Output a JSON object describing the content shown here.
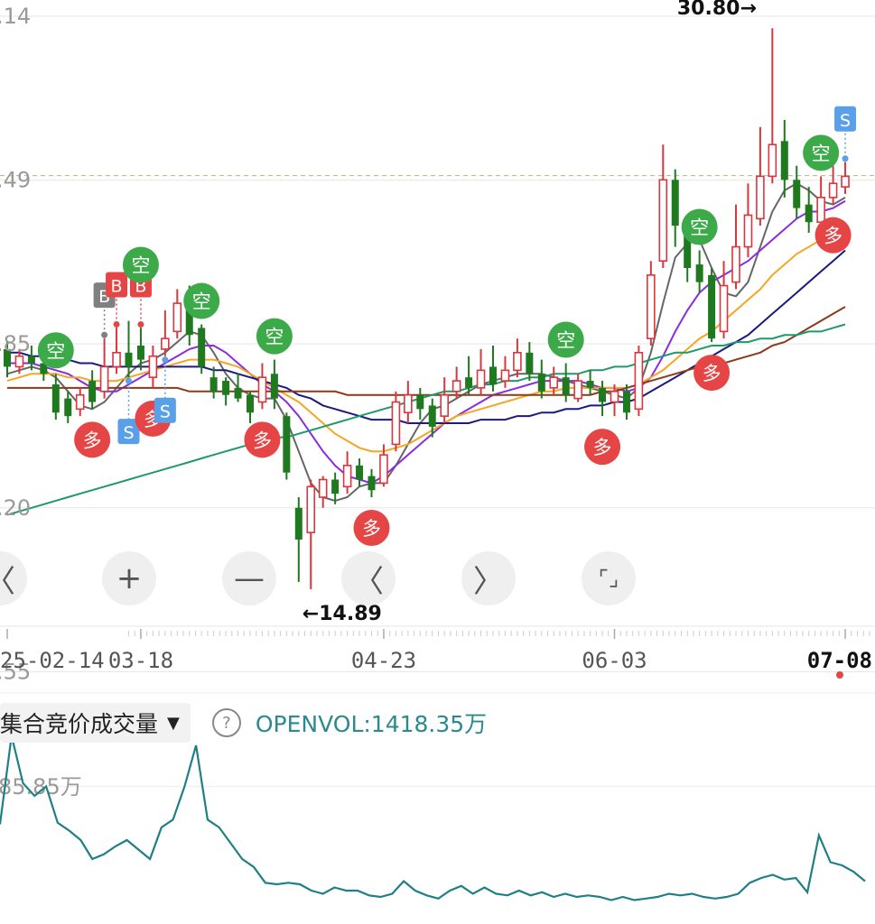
{
  "chart_data": {
    "type": "candlestick",
    "price_axis": {
      "ylim": [
        14.2,
        31.6
      ],
      "tick_labels": [
        ".14",
        ".49",
        ".85",
        ".20",
        ".55"
      ],
      "tick_values": [
        31.14,
        26.49,
        21.85,
        17.2,
        12.55
      ],
      "reference_line": 26.62
    },
    "max_marker": {
      "label": "30.80→",
      "value": 30.8,
      "day": 62
    },
    "min_marker": {
      "label": "←14.89",
      "value": 14.89,
      "day": 24
    },
    "x_ticks": [
      {
        "label": "25-02-14",
        "day": 0
      },
      {
        "label": "03-18",
        "day": 11
      },
      {
        "label": "04-23",
        "day": 31
      },
      {
        "label": "06-03",
        "day": 50
      },
      {
        "label": "07-08",
        "day": 69
      }
    ],
    "candles": [
      [
        21.7,
        21.2,
        21.9,
        20.9
      ],
      [
        21.2,
        21.5,
        21.7,
        21.0
      ],
      [
        21.5,
        21.3,
        21.8,
        21.1
      ],
      [
        21.3,
        21.0,
        21.6,
        20.8
      ],
      [
        20.7,
        19.9,
        21.0,
        19.7
      ],
      [
        20.3,
        19.8,
        20.5,
        19.6
      ],
      [
        20.0,
        20.4,
        20.6,
        19.8
      ],
      [
        20.8,
        20.2,
        21.1,
        20.0
      ],
      [
        20.5,
        21.2,
        22.0,
        20.3
      ],
      [
        21.2,
        21.6,
        22.3,
        21.0
      ],
      [
        21.6,
        21.2,
        22.5,
        20.9
      ],
      [
        21.8,
        21.4,
        22.3,
        21.1
      ],
      [
        20.9,
        21.5,
        21.8,
        20.6
      ],
      [
        21.7,
        22.0,
        22.8,
        21.5
      ],
      [
        22.2,
        23.0,
        23.4,
        22.0
      ],
      [
        23.0,
        22.1,
        23.5,
        21.8
      ],
      [
        22.3,
        21.2,
        22.4,
        21.0
      ],
      [
        20.9,
        20.5,
        21.2,
        20.3
      ],
      [
        20.8,
        20.4,
        20.9,
        20.1
      ],
      [
        20.6,
        20.3,
        21.0,
        20.2
      ],
      [
        20.4,
        19.9,
        20.5,
        19.6
      ],
      [
        20.2,
        20.9,
        21.3,
        20.0
      ],
      [
        21.0,
        20.3,
        21.4,
        20.0
      ],
      [
        19.8,
        18.2,
        19.9,
        18.0
      ],
      [
        17.2,
        16.3,
        17.5,
        15.1
      ],
      [
        16.5,
        17.8,
        18.0,
        14.89
      ],
      [
        17.5,
        18.0,
        18.1,
        17.2
      ],
      [
        18.0,
        17.6,
        18.2,
        17.3
      ],
      [
        17.8,
        18.4,
        18.8,
        17.6
      ],
      [
        18.4,
        18.0,
        18.6,
        17.8
      ],
      [
        18.1,
        17.7,
        18.3,
        17.5
      ],
      [
        17.9,
        18.7,
        19.0,
        17.8
      ],
      [
        19.0,
        20.2,
        20.5,
        18.8
      ],
      [
        19.9,
        20.4,
        20.8,
        19.6
      ],
      [
        20.4,
        20.0,
        20.6,
        19.7
      ],
      [
        20.1,
        19.5,
        20.3,
        19.2
      ],
      [
        19.8,
        20.4,
        20.9,
        19.6
      ],
      [
        20.5,
        20.8,
        21.2,
        20.3
      ],
      [
        20.9,
        20.6,
        21.5,
        20.4
      ],
      [
        20.6,
        21.1,
        21.7,
        20.4
      ],
      [
        21.2,
        20.7,
        21.8,
        20.5
      ],
      [
        20.8,
        21.1,
        21.5,
        20.6
      ],
      [
        21.1,
        21.6,
        22.0,
        20.9
      ],
      [
        21.6,
        21.0,
        21.9,
        20.8
      ],
      [
        21.0,
        20.5,
        21.4,
        20.3
      ],
      [
        20.6,
        20.9,
        21.2,
        20.4
      ],
      [
        20.9,
        20.4,
        21.3,
        20.2
      ],
      [
        20.3,
        20.8,
        21.0,
        20.2
      ],
      [
        20.8,
        20.6,
        21.1,
        20.4
      ],
      [
        20.6,
        20.2,
        20.8,
        19.8
      ],
      [
        20.2,
        20.5,
        20.7,
        19.8
      ],
      [
        20.5,
        19.9,
        20.7,
        19.7
      ],
      [
        20.0,
        21.6,
        21.8,
        19.8
      ],
      [
        22.0,
        23.8,
        24.2,
        21.8
      ],
      [
        24.2,
        26.5,
        27.5,
        24.0
      ],
      [
        26.5,
        25.2,
        26.8,
        24.6
      ],
      [
        25.0,
        24.0,
        25.3,
        23.6
      ],
      [
        24.1,
        23.6,
        24.5,
        23.3
      ],
      [
        23.8,
        22.0,
        24.0,
        21.9
      ],
      [
        22.2,
        23.5,
        24.2,
        22.0
      ],
      [
        23.6,
        24.6,
        25.8,
        23.4
      ],
      [
        24.6,
        25.5,
        26.4,
        24.3
      ],
      [
        25.4,
        26.6,
        28.0,
        25.2
      ],
      [
        26.6,
        27.5,
        30.8,
        26.4
      ],
      [
        27.6,
        26.5,
        28.2,
        26.0
      ],
      [
        26.5,
        25.7,
        26.9,
        25.4
      ],
      [
        25.8,
        25.3,
        26.3,
        25.0
      ],
      [
        25.3,
        26.0,
        26.6,
        25.2
      ],
      [
        26.0,
        26.4,
        26.9,
        25.8
      ],
      [
        26.3,
        26.6,
        27.0,
        26.1
      ]
    ],
    "signals": [
      {
        "label": "空",
        "day": 4,
        "kind": "short",
        "pos": "above"
      },
      {
        "label": "多",
        "day": 7,
        "kind": "long",
        "pos": "below"
      },
      {
        "label": "B",
        "day": 8,
        "kind": "buy-gray",
        "pos": "above"
      },
      {
        "label": "B",
        "day": 9,
        "kind": "buy",
        "pos": "above"
      },
      {
        "label": "B",
        "day": 11,
        "kind": "buy",
        "pos": "above"
      },
      {
        "label": "空",
        "day": 11,
        "kind": "short",
        "pos": "above"
      },
      {
        "label": "S",
        "day": 10,
        "kind": "sell",
        "pos": "below"
      },
      {
        "label": "多",
        "day": 12,
        "kind": "long",
        "pos": "below"
      },
      {
        "label": "S",
        "day": 13,
        "kind": "sell",
        "pos": "below"
      },
      {
        "label": "空",
        "day": 16,
        "kind": "short",
        "pos": "above"
      },
      {
        "label": "空",
        "day": 22,
        "kind": "short",
        "pos": "above"
      },
      {
        "label": "多",
        "day": 21,
        "kind": "long",
        "pos": "below"
      },
      {
        "label": "多",
        "day": 30,
        "kind": "long",
        "pos": "below"
      },
      {
        "label": "空",
        "day": 46,
        "kind": "short",
        "pos": "above"
      },
      {
        "label": "多",
        "day": 49,
        "kind": "long",
        "pos": "below"
      },
      {
        "label": "空",
        "day": 57,
        "kind": "short",
        "pos": "above"
      },
      {
        "label": "多",
        "day": 58,
        "kind": "long",
        "pos": "below"
      },
      {
        "label": "空",
        "day": 67,
        "kind": "short",
        "pos": "above"
      },
      {
        "label": "S",
        "day": 69,
        "kind": "sell",
        "pos": "above"
      },
      {
        "label": "多",
        "day": 68,
        "kind": "long",
        "pos": "below"
      }
    ],
    "ma_series": [
      {
        "color": "#666666",
        "values": [
          21.0,
          21.1,
          21.2,
          21.1,
          20.9,
          20.5,
          20.1,
          20.0,
          20.2,
          20.6,
          21.0,
          21.3,
          21.4,
          21.6,
          21.9,
          22.2,
          22.1,
          21.6,
          21.0,
          20.6,
          20.4,
          20.3,
          20.3,
          19.7,
          18.8,
          17.9,
          17.5,
          17.4,
          17.5,
          17.8,
          17.9,
          17.9,
          18.4,
          19.0,
          19.6,
          20.0,
          20.1,
          20.3,
          20.5,
          20.7,
          20.8,
          20.9,
          21.0,
          21.0,
          21.0,
          20.9,
          20.8,
          20.7,
          20.6,
          20.5,
          20.4,
          20.3,
          20.6,
          21.6,
          23.0,
          24.3,
          24.7,
          24.8,
          24.0,
          23.3,
          23.2,
          23.6,
          24.6,
          25.6,
          26.2,
          26.4,
          26.2,
          25.9,
          25.8,
          26.0
        ]
      },
      {
        "color": "#8a2be2",
        "values": [
          21.3,
          21.3,
          21.3,
          21.2,
          21.1,
          21.0,
          20.8,
          20.6,
          20.5,
          20.5,
          20.7,
          20.9,
          21.1,
          21.3,
          21.5,
          21.7,
          21.8,
          21.8,
          21.6,
          21.3,
          21.0,
          20.7,
          20.5,
          20.2,
          19.8,
          19.3,
          18.8,
          18.4,
          18.1,
          18.0,
          17.9,
          18.1,
          18.4,
          18.7,
          19.0,
          19.3,
          19.6,
          19.8,
          20.0,
          20.2,
          20.4,
          20.5,
          20.6,
          20.7,
          20.8,
          20.8,
          20.8,
          20.8,
          20.7,
          20.6,
          20.6,
          20.5,
          20.6,
          20.9,
          21.5,
          22.2,
          22.8,
          23.3,
          23.6,
          23.8,
          24.0,
          24.2,
          24.5,
          24.8,
          25.1,
          25.4,
          25.6,
          25.6,
          25.7,
          25.9
        ]
      },
      {
        "color": "#f5a623",
        "values": [
          20.8,
          20.9,
          21.0,
          21.0,
          21.0,
          20.9,
          20.9,
          20.8,
          20.8,
          20.8,
          20.9,
          21.0,
          21.1,
          21.2,
          21.3,
          21.4,
          21.4,
          21.4,
          21.3,
          21.2,
          21.0,
          20.8,
          20.6,
          20.4,
          20.2,
          19.9,
          19.6,
          19.3,
          19.1,
          18.9,
          18.8,
          18.8,
          18.9,
          19.0,
          19.2,
          19.4,
          19.6,
          19.8,
          19.9,
          20.0,
          20.1,
          20.2,
          20.3,
          20.4,
          20.5,
          20.5,
          20.6,
          20.6,
          20.6,
          20.6,
          20.6,
          20.6,
          20.7,
          20.9,
          21.1,
          21.4,
          21.7,
          22.0,
          22.2,
          22.5,
          22.8,
          23.1,
          23.4,
          23.8,
          24.1,
          24.4,
          24.6,
          24.8,
          25.0,
          25.2
        ]
      },
      {
        "color": "#1a1a80",
        "values": [
          21.6,
          21.6,
          21.5,
          21.5,
          21.4,
          21.4,
          21.3,
          21.3,
          21.2,
          21.2,
          21.2,
          21.2,
          21.2,
          21.2,
          21.2,
          21.2,
          21.2,
          21.1,
          21.1,
          21.0,
          20.9,
          20.8,
          20.7,
          20.6,
          20.4,
          20.3,
          20.1,
          20.0,
          19.9,
          19.8,
          19.7,
          19.7,
          19.7,
          19.6,
          19.6,
          19.6,
          19.6,
          19.6,
          19.6,
          19.7,
          19.7,
          19.7,
          19.8,
          19.8,
          19.9,
          19.9,
          20.0,
          20.0,
          20.1,
          20.1,
          20.2,
          20.2,
          20.3,
          20.5,
          20.7,
          20.9,
          21.1,
          21.3,
          21.5,
          21.7,
          21.9,
          22.1,
          22.4,
          22.7,
          23.0,
          23.3,
          23.6,
          23.9,
          24.2,
          24.5
        ]
      },
      {
        "color": "#8b3a1a",
        "values": [
          20.6,
          20.6,
          20.6,
          20.6,
          20.6,
          20.6,
          20.6,
          20.6,
          20.6,
          20.6,
          20.6,
          20.6,
          20.6,
          20.6,
          20.6,
          20.5,
          20.5,
          20.5,
          20.5,
          20.5,
          20.5,
          20.5,
          20.5,
          20.5,
          20.5,
          20.5,
          20.5,
          20.5,
          20.4,
          20.4,
          20.4,
          20.4,
          20.4,
          20.4,
          20.4,
          20.4,
          20.4,
          20.4,
          20.4,
          20.4,
          20.4,
          20.4,
          20.4,
          20.4,
          20.4,
          20.4,
          20.4,
          20.4,
          20.4,
          20.5,
          20.5,
          20.6,
          20.7,
          20.8,
          20.9,
          21.0,
          21.1,
          21.2,
          21.3,
          21.3,
          21.4,
          21.5,
          21.6,
          21.8,
          21.9,
          22.1,
          22.3,
          22.5,
          22.7,
          22.9
        ]
      },
      {
        "color": "#1e9a6a",
        "values": [
          17.0,
          17.1,
          17.2,
          17.3,
          17.4,
          17.5,
          17.6,
          17.7,
          17.8,
          17.9,
          18.0,
          18.1,
          18.2,
          18.3,
          18.4,
          18.5,
          18.6,
          18.7,
          18.8,
          18.9,
          19.0,
          19.1,
          19.2,
          19.2,
          19.3,
          19.4,
          19.5,
          19.6,
          19.7,
          19.8,
          19.9,
          20.0,
          20.1,
          20.2,
          20.3,
          20.4,
          20.5,
          20.5,
          20.6,
          20.7,
          20.7,
          20.8,
          20.8,
          20.9,
          20.9,
          21.0,
          21.0,
          21.0,
          21.1,
          21.1,
          21.2,
          21.2,
          21.3,
          21.4,
          21.5,
          21.6,
          21.6,
          21.7,
          21.8,
          21.8,
          21.9,
          21.9,
          22.0,
          22.0,
          22.1,
          22.1,
          22.2,
          22.2,
          22.3,
          22.4
        ]
      }
    ],
    "indicator": {
      "name": "集合竞价成交量",
      "label": "OPENVOL:1418.35万",
      "axis_label": "85.85万",
      "axis_value": 85.85,
      "ylim": [
        0,
        112
      ],
      "values": [
        62,
        118,
        88,
        80,
        86,
        63,
        58,
        52,
        40,
        43,
        48,
        52,
        46,
        40,
        60,
        65,
        86,
        112,
        65,
        60,
        50,
        40,
        35,
        25,
        24,
        25,
        24,
        20,
        18,
        22,
        20,
        20,
        17,
        16,
        18,
        26,
        20,
        17,
        15,
        20,
        23,
        18,
        22,
        18,
        17,
        20,
        17,
        19,
        16,
        18,
        16,
        17,
        16,
        14,
        16,
        14,
        15,
        16,
        18,
        17,
        18,
        16,
        15,
        16,
        18,
        25,
        28,
        30,
        27,
        28,
        19,
        55,
        38,
        36,
        32,
        26
      ]
    },
    "series_colors": {
      "up": "#d9363e",
      "down": "#1f7a1f",
      "short": "#3daa4a",
      "long": "#e64545",
      "sell": "#5aa0e8",
      "buy": "#e64545",
      "buy-gray": "#808080"
    }
  },
  "controls": {
    "left": "〈",
    "zoom_in": "+",
    "zoom_out": "—",
    "prev": "〈",
    "next": "〉",
    "fullscreen": "⌜⌟"
  },
  "indicator_bar": {
    "selector": "集合竞价成交量",
    "help": "?",
    "value": "OPENVOL:1418.35万"
  }
}
